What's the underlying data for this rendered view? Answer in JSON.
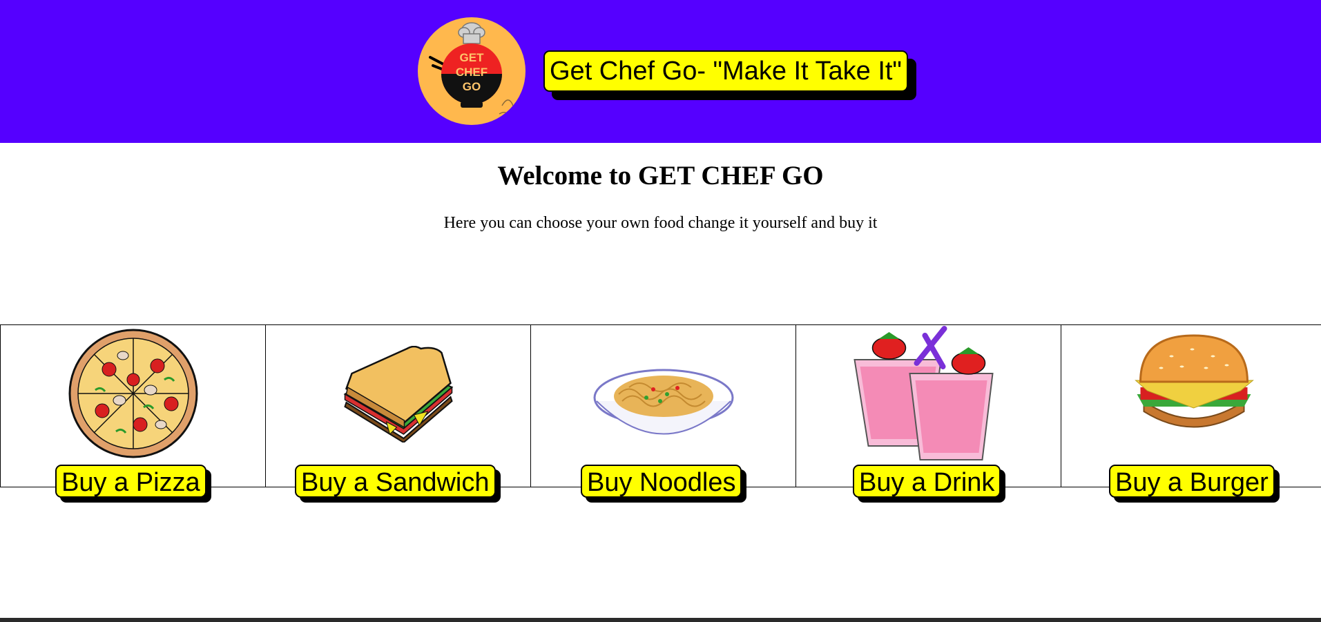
{
  "header": {
    "logo_text": [
      "GET",
      "CHEF",
      "GO"
    ],
    "tagline": "Get Chef Go- \"Make It Take It\"",
    "background": "#5500ff"
  },
  "main": {
    "title": "Welcome to GET CHEF GO",
    "subtitle": "Here you can choose your own food change it yourself and buy it"
  },
  "products": [
    {
      "label": "Buy a Pizza",
      "icon": "pizza-icon"
    },
    {
      "label": "Buy a Sandwich",
      "icon": "sandwich-icon"
    },
    {
      "label": "Buy Noodles",
      "icon": "noodles-icon"
    },
    {
      "label": "Buy a Drink",
      "icon": "drink-icon"
    },
    {
      "label": "Buy a Burger",
      "icon": "burger-icon"
    }
  ],
  "colors": {
    "header": "#5500ff",
    "button": "#ffff00",
    "logo_bg": "#ffb84d"
  }
}
